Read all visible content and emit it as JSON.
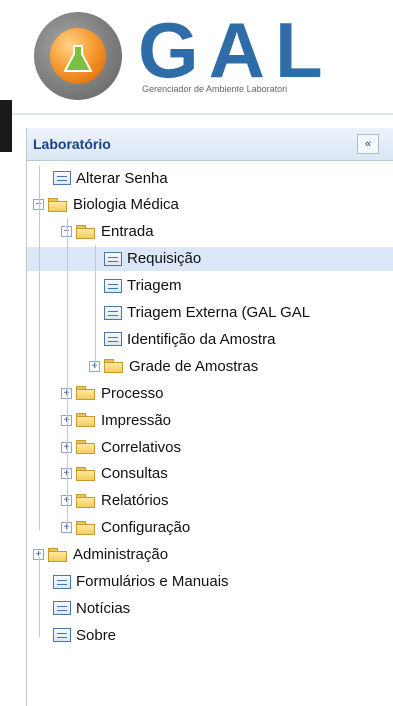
{
  "header": {
    "logo_text": "GAL",
    "subtitle": "Gerenciador de Ambiente Laboratori"
  },
  "panel": {
    "title": "Laboratório",
    "collapse_symbol": "«"
  },
  "tree": [
    {
      "label": "Alterar Senha",
      "type": "page"
    },
    {
      "label": "Biologia Médica",
      "type": "folder",
      "expanded": true
    },
    {
      "label": "Entrada",
      "type": "folder",
      "expanded": true
    },
    {
      "label": "Requisição",
      "type": "page",
      "selected": true
    },
    {
      "label": "Triagem",
      "type": "page"
    },
    {
      "label": "Triagem Externa (GAL GAL",
      "type": "page"
    },
    {
      "label": "Identifição da Amostra",
      "type": "page"
    },
    {
      "label": "Grade de Amostras",
      "type": "folder",
      "expanded": false
    },
    {
      "label": "Processo",
      "type": "folder",
      "expanded": false
    },
    {
      "label": "Impressão",
      "type": "folder",
      "expanded": false
    },
    {
      "label": "Correlativos",
      "type": "folder",
      "expanded": false
    },
    {
      "label": "Consultas",
      "type": "folder",
      "expanded": false
    },
    {
      "label": "Relatórios",
      "type": "folder",
      "expanded": false
    },
    {
      "label": "Configuração",
      "type": "folder",
      "expanded": false
    },
    {
      "label": "Administração",
      "type": "folder",
      "expanded": false
    },
    {
      "label": "Formulários e Manuais",
      "type": "page"
    },
    {
      "label": "Notícias",
      "type": "page"
    },
    {
      "label": "Sobre",
      "type": "page"
    }
  ],
  "icons": {
    "page": "page-icon",
    "folder": "folder-icon",
    "expand": "expand-plus-icon",
    "collapse": "collapse-minus-icon"
  }
}
